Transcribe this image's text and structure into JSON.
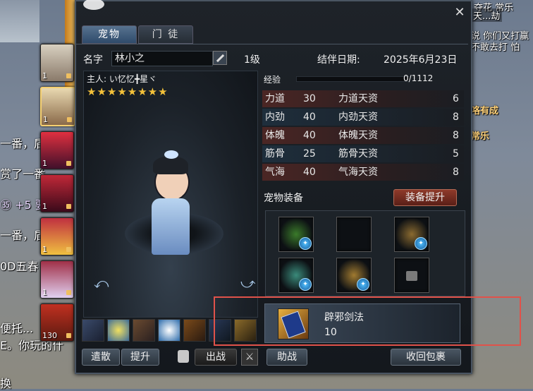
{
  "background": {
    "chat_left": [
      "一番，盾",
      "赏了一番",
      "㉟ +5 要而",
      "一番，盾",
      "0D五春",
      "便托...",
      "E。你玩的什",
      "换"
    ],
    "right_top": [
      "夺花 常乐",
      "天...劫",
      "说 你们又打赢",
      "不敢去打 怕"
    ],
    "right_guild": [
      "咯有成",
      "常乐"
    ]
  },
  "pet_list": [
    {
      "level": "1",
      "selected": false
    },
    {
      "level": "1",
      "selected": true
    },
    {
      "level": "1",
      "selected": false
    },
    {
      "level": "1",
      "selected": false
    },
    {
      "level": "1",
      "selected": false
    },
    {
      "level": "1",
      "selected": false
    },
    {
      "level": "130",
      "selected": false
    }
  ],
  "window": {
    "close_icon": "close-icon",
    "tabs": [
      {
        "label": "宠物",
        "active": true
      },
      {
        "label": "门 徒",
        "active": false
      }
    ],
    "name_label": "名字",
    "name_value": "林小之",
    "level": "1级",
    "bond_label": "结伴日期:",
    "bond_date": "2025年6月23日",
    "owner": "主人: い忆忆╋星ヾ",
    "stars": "★★★★★★★★",
    "exp_label": "经验",
    "exp_value": "0/1112",
    "exp_progress": 0,
    "stats": [
      {
        "name": "力道",
        "value": "30",
        "talent_name": "力道天资",
        "talent": "6"
      },
      {
        "name": "内劲",
        "value": "40",
        "talent_name": "内劲天资",
        "talent": "8"
      },
      {
        "name": "体魄",
        "value": "40",
        "talent_name": "体魄天资",
        "talent": "8"
      },
      {
        "name": "筋骨",
        "value": "25",
        "talent_name": "筋骨天资",
        "talent": "5"
      },
      {
        "name": "气海",
        "value": "40",
        "talent_name": "气海天资",
        "talent": "8"
      }
    ],
    "equip_title": "宠物装备",
    "equip_upgrade": "装备提升",
    "book_name": "辟邪剑法",
    "book_count": "10",
    "buttons": {
      "release": "遣散",
      "upgrade": "提升",
      "battle": "出战",
      "assist": "助战",
      "recall": "收回包裹"
    }
  }
}
